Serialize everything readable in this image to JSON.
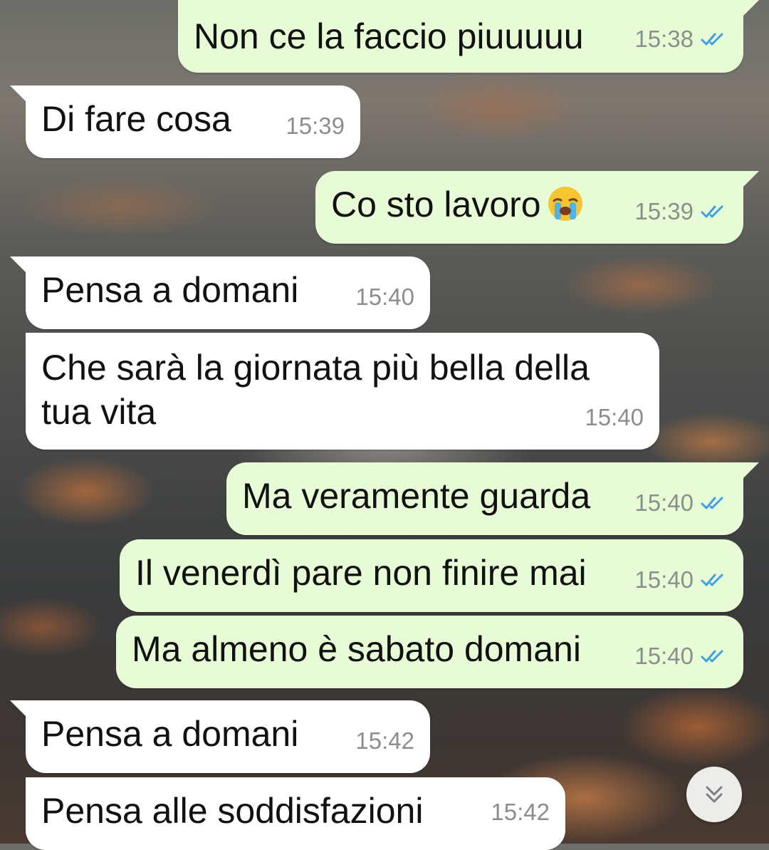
{
  "messages": [
    {
      "direction": "out",
      "text": "Non ce la faccio piuuuuu",
      "time": "15:38",
      "status": "read"
    },
    {
      "direction": "in",
      "text": "Di fare cosa",
      "time": "15:39"
    },
    {
      "direction": "out",
      "text": "Co sto lavoro",
      "emoji": "loudly-crying-face",
      "time": "15:39",
      "status": "read"
    },
    {
      "direction": "in",
      "text": "Pensa a domani",
      "time": "15:40"
    },
    {
      "direction": "in",
      "text": "Che sarà la giornata più bella della tua vita",
      "time": "15:40"
    },
    {
      "direction": "out",
      "text": "Ma veramente guarda",
      "time": "15:40",
      "status": "read"
    },
    {
      "direction": "out",
      "text": "Il venerdì pare non finire mai",
      "time": "15:40",
      "status": "read"
    },
    {
      "direction": "out",
      "text": "Ma almeno è sabato domani",
      "time": "15:40",
      "status": "read"
    },
    {
      "direction": "in",
      "text": "Pensa a domani",
      "time": "15:42"
    },
    {
      "direction": "in",
      "text": "Pensa alle soddisfazioni",
      "time": "15:42"
    }
  ],
  "colors": {
    "outgoing_bubble": "#e7fcd6",
    "incoming_bubble": "#ffffff",
    "read_ticks": "#3f9fe0",
    "timestamp": "#8b8f8c"
  },
  "scroll_button": {
    "icon": "double-chevron-down-icon"
  }
}
